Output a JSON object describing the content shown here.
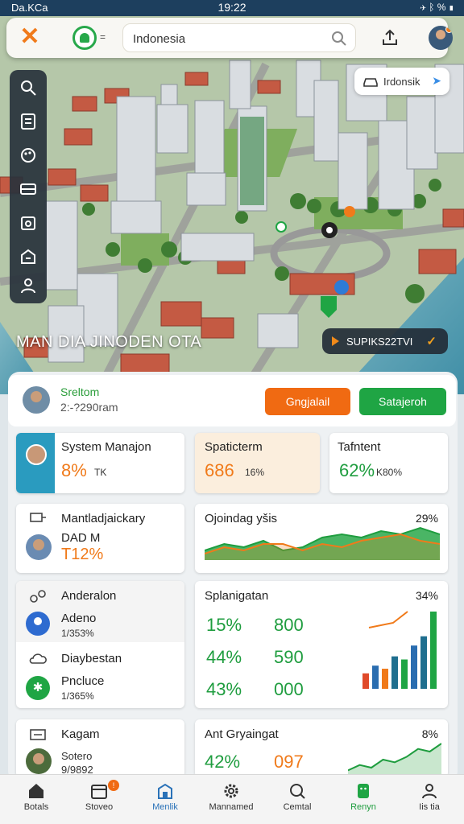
{
  "status_bar": {
    "carrier": "Da.KCa",
    "time": "19:22",
    "battery": "%"
  },
  "topbar": {
    "search_value": "Indonesia",
    "search_placeholder": "Search"
  },
  "location_chip": {
    "label": "Irdonsik"
  },
  "map_title": "MAN DIA JINODEN OTA",
  "route_chip": {
    "label": "SUPIKS22TVI"
  },
  "colors": {
    "orange": "#f07a1a",
    "green": "#1fa544",
    "navy": "#1d3f5e"
  },
  "profile": {
    "name": "Sreltom",
    "subtitle": "2:-?290ram",
    "button_orange": "Gngjalail",
    "button_green": "Satajeroh"
  },
  "stats": [
    {
      "title": "System Manajon",
      "value": "8%",
      "unit": "TK"
    },
    {
      "title": "Spaticterm",
      "value": "686",
      "unit": "16%"
    },
    {
      "title": "Tafntent",
      "value": "62%",
      "unit": "K80%"
    }
  ],
  "left_card_1": {
    "title": "Mantladjaickary",
    "user_name": "DAD M",
    "value": "T12%"
  },
  "chart_card_1": {
    "title": "Ojoindag yšis",
    "percent": "29%"
  },
  "left_card_2": {
    "row1_title": "Anderalon",
    "row1_name": "Adeno",
    "row1_sub": "1/353%",
    "row2_title": "Diaybestan",
    "row2_name": "Pncluce",
    "row2_sub": "1/365%"
  },
  "chart_card_2": {
    "title": "Splanigatan",
    "percent": "34%",
    "rows": [
      {
        "pct": "15%",
        "num": "800"
      },
      {
        "pct": "44%",
        "num": "590"
      },
      {
        "pct": "43%",
        "num": "000"
      }
    ]
  },
  "left_card_3": {
    "title": "Kagam",
    "name": "Sotero",
    "sub": "9/9892"
  },
  "chart_card_3": {
    "title": "Ant Gryaingat",
    "percent": "8%",
    "pct": "42%",
    "num": "097"
  },
  "chart_data": [
    {
      "type": "area",
      "series": [
        {
          "values": [
            3,
            5,
            4,
            6,
            3,
            4,
            7,
            8,
            7,
            9,
            8,
            10,
            8
          ]
        },
        {
          "values": [
            2,
            4,
            3,
            5,
            5,
            3,
            5,
            4,
            6,
            7,
            8,
            6,
            5
          ]
        }
      ]
    },
    {
      "type": "bar",
      "values": [
        2,
        3,
        2.6,
        4.2,
        3.8,
        5.6,
        6.8,
        10
      ]
    },
    {
      "type": "area",
      "series": [
        {
          "values": [
            1,
            2,
            1.5,
            3,
            2.5,
            3.5,
            5,
            4.5,
            6
          ]
        }
      ]
    }
  ],
  "nav": [
    {
      "label": "Botals",
      "icon": "home-icon"
    },
    {
      "label": "Stoveo",
      "icon": "calendar-icon",
      "badge": "!"
    },
    {
      "label": "Menlik",
      "icon": "building-icon"
    },
    {
      "label": "Mannamed",
      "icon": "gear-icon"
    },
    {
      "label": "Cemtal",
      "icon": "search-icon"
    },
    {
      "label": "Renyn",
      "icon": "android-icon"
    },
    {
      "label": "Iis tia",
      "icon": "user-icon"
    }
  ]
}
